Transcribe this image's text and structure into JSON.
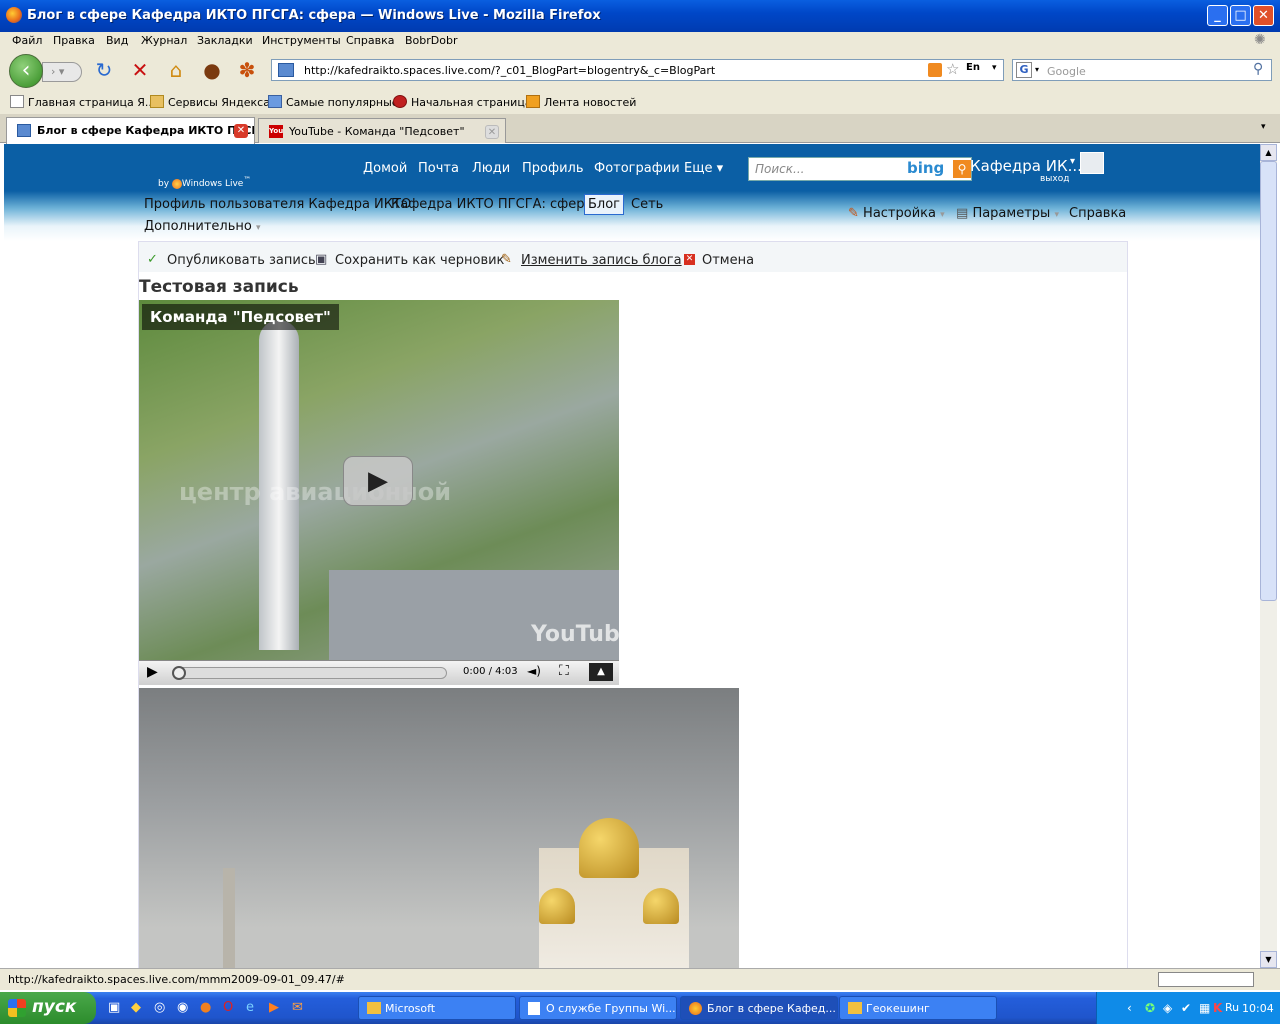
{
  "window": {
    "title": "Блог в сфере Кафедра ИКТО ПГСГА: сфера — Windows Live - Mozilla Firefox"
  },
  "menu": [
    "Файл",
    "Правка",
    "Вид",
    "Журнал",
    "Закладки",
    "Инструменты",
    "Справка",
    "BobrDobr"
  ],
  "address": {
    "url": "http://kafedraikto.spaces.live.com/?_c01_BlogPart=blogentry&_c=BlogPart",
    "lang": "En",
    "search_placeholder": "Google"
  },
  "bookmarks": [
    "Главная страница Я...",
    "Сервисы Яндекса",
    "Самые популярные",
    "Начальная страница",
    "Лента новостей"
  ],
  "tabs": [
    {
      "label": "Блог в сфере Кафедра ИКТО ПГСГ...",
      "active": true
    },
    {
      "label": "YouTube - Команда \"Педсовет\"",
      "active": false
    }
  ],
  "wl": {
    "by": "by",
    "brand": "Windows Live",
    "tm": "™",
    "nav": [
      "Домой",
      "Почта",
      "Люди",
      "Профиль",
      "Фотографии",
      "Еще ▾"
    ],
    "search_placeholder": "Поиск...",
    "bing": "bing",
    "user": "Кафедра ИК...",
    "logout": "выход",
    "sub": [
      "Профиль пользователя Кафедра ИКТО",
      "Кафедра ИКТО ПГСГА: сфер...",
      "Блог",
      "Сеть"
    ],
    "more": "Дополнительно",
    "right": [
      "Настройка",
      "Параметры",
      "Справка"
    ]
  },
  "actions": [
    "Опубликовать запись",
    "Сохранить как черновик",
    "Изменить запись блога",
    "Отмена"
  ],
  "post": {
    "title": "Тестовая запись"
  },
  "video": {
    "title": "Команда \"Педсовет\"",
    "overlay_text": "центр авиационной",
    "time": "0:00 / 4:03",
    "logo": "YouTube"
  },
  "status": {
    "text": "http://kafedraikto.spaces.live.com/mmm2009-09-01_09.47/#"
  },
  "taskbar": {
    "start": "пуск",
    "tasks": [
      "Microsoft",
      "О службе Группы Wi...",
      "Блог в сфере Кафед...",
      "Геокешинг"
    ],
    "lang": "RU",
    "kbd": "Ru",
    "clock": "10:04"
  }
}
